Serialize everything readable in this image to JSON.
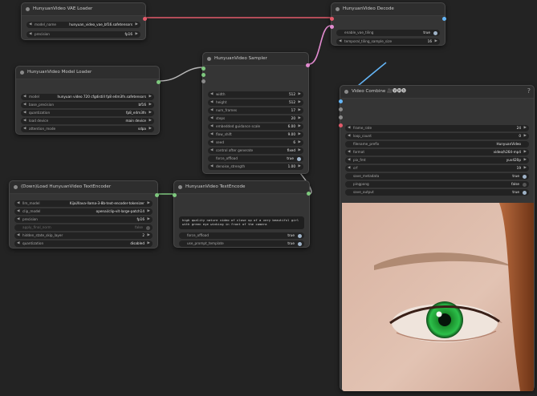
{
  "colors": {
    "background": "#232323",
    "node": "#353535",
    "vae_link": "#e25a6a",
    "model_link": "#b8b8b8",
    "latent_link": "#e28bd0",
    "image_link": "#64b5f6"
  },
  "vae_loader": {
    "title": "HunyuanVideo VAE Loader",
    "model_name": {
      "label": "model_name",
      "value": "hunyuan_video_vae_bf16.safetensors"
    },
    "precision": {
      "label": "precision",
      "value": "fp16"
    }
  },
  "decode": {
    "title": "HunyuanVideo Decode",
    "enable_vae_tiling": {
      "label": "enable_vae_tiling",
      "value": "true"
    },
    "temporal_tiling_sample_size": {
      "label": "temporal_tiling_sample_size",
      "value": "16"
    }
  },
  "model_loader": {
    "title": "HunyuanVideo Model Loader",
    "model": {
      "label": "model",
      "value": "hunyuan video 720 cfgdistill fp8 e4m3fn.safetensors"
    },
    "base_precision": {
      "label": "base_precision",
      "value": "bf16"
    },
    "quantization": {
      "label": "quantization",
      "value": "fp8_e4m3fn"
    },
    "load_device": {
      "label": "load device",
      "value": "main device"
    },
    "attention_mode": {
      "label": "attention_mode",
      "value": "sdpa"
    }
  },
  "sampler": {
    "title": "HunyuanVideo Sampler",
    "width": {
      "label": "width",
      "value": "512"
    },
    "height": {
      "label": "height",
      "value": "512"
    },
    "num_frames": {
      "label": "num_frames",
      "value": "17"
    },
    "steps": {
      "label": "steps",
      "value": "20"
    },
    "embedded_guidance_scale": {
      "label": "embedded guidance scale",
      "value": "6.00"
    },
    "flow_shift": {
      "label": "flow_shift",
      "value": "9.00"
    },
    "seed": {
      "label": "seed",
      "value": "6"
    },
    "control_after_generate": {
      "label": "control after generate",
      "value": "fixed"
    },
    "force_offload": {
      "label": "force_offload",
      "value": "true"
    },
    "denoise_strength": {
      "label": "denoise_strength",
      "value": "1.00"
    }
  },
  "text_loader": {
    "title": "(Down)Load HunyuanVideo TextEncoder",
    "llm_model": {
      "label": "llm_model",
      "value": "Kijai/llava-llama-3-8b-text-encoder-tokenizer"
    },
    "clip_model": {
      "label": "clip_model",
      "value": "openai/clip-vit-large-patch14"
    },
    "precision": {
      "label": "precision",
      "value": "fp16"
    },
    "apply_final_norm": {
      "label": "apply_final_norm",
      "value": "false"
    },
    "hidden_state_skip_layer": {
      "label": "hidden_state_skip_layer",
      "value": "2"
    },
    "quantization": {
      "label": "quantization",
      "value": "disabled"
    }
  },
  "text_encode": {
    "title": "HunyuanVideo TextEncode",
    "prompt": "high quality nature video of close up of a very beautiful girl with green eye winking in front of the camera",
    "force_offload": {
      "label": "force_offload",
      "value": "true"
    },
    "prompt_template": {
      "label": "use_prompt_template",
      "value": "true"
    }
  },
  "combine": {
    "title": "Video Combine 🎥🅥🅗🅢",
    "frame_rate": {
      "label": "frame_rate",
      "value": "24"
    },
    "loop_count": {
      "label": "loop_count",
      "value": "0"
    },
    "filename_prefix": {
      "label": "filename_prefix",
      "value": "HunyuanVideo"
    },
    "format": {
      "label": "format",
      "value": "video/h264-mp4"
    },
    "pix_fmt": {
      "label": "pix_fmt",
      "value": "yuv420p"
    },
    "crf": {
      "label": "crf",
      "value": "19"
    },
    "save_metadata": {
      "label": "save_metadata",
      "value": "true"
    },
    "pingpong": {
      "label": "pingpong",
      "value": "false"
    },
    "save_output": {
      "label": "save_output",
      "value": "true"
    },
    "help": "?"
  },
  "icons": [
    "collapse-dot-icon",
    "arrow-left-icon",
    "arrow-right-icon",
    "toggle-icon",
    "help-icon"
  ]
}
